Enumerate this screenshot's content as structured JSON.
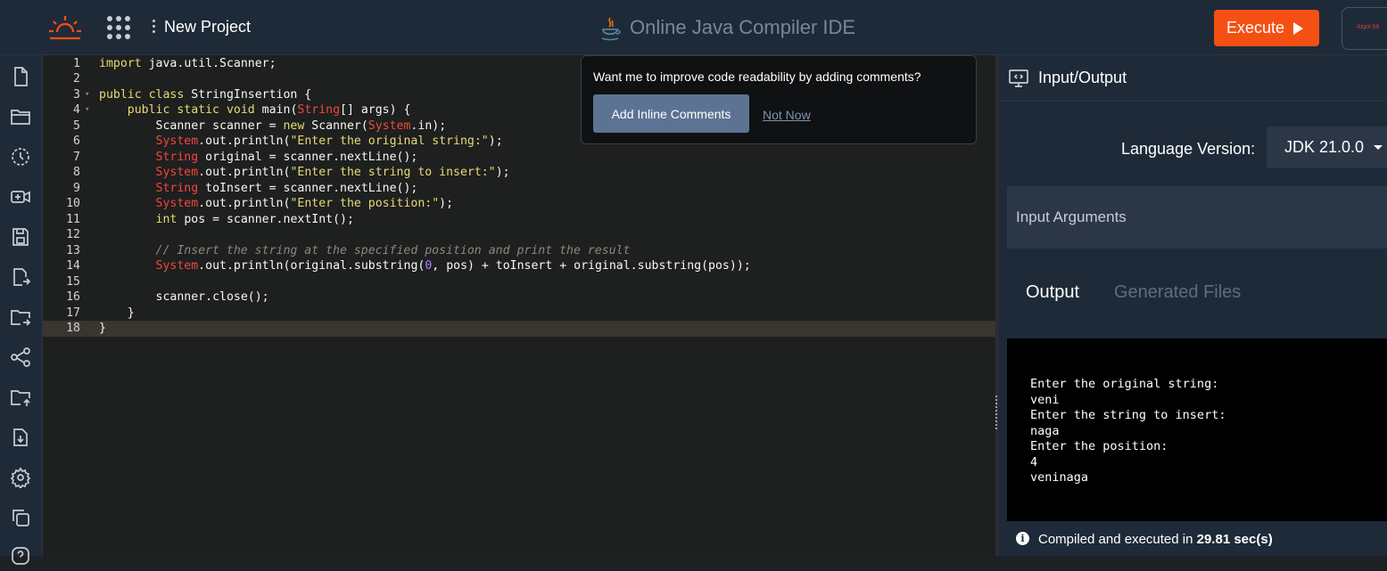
{
  "header": {
    "logo": "sun-logo-icon",
    "apps_icon": "apps-grid-icon",
    "menu_icon": "kebab-menu-icon",
    "project_name": "New Project",
    "java_icon": "java-cup-icon",
    "title": "Online Java Compiler IDE",
    "execute_label": "Execute",
    "ad_text": "Algol 68"
  },
  "sidebar": {
    "items": [
      {
        "icon": "new-file-icon"
      },
      {
        "icon": "open-folder-icon"
      },
      {
        "icon": "history-icon"
      },
      {
        "icon": "video-icon"
      },
      {
        "icon": "save-icon"
      },
      {
        "icon": "export-file-icon"
      },
      {
        "icon": "move-folder-icon"
      },
      {
        "icon": "share-icon"
      },
      {
        "icon": "upload-folder-icon"
      },
      {
        "icon": "download-file-icon"
      },
      {
        "icon": "settings-icon"
      },
      {
        "icon": "copy-icon"
      },
      {
        "icon": "help-icon"
      }
    ]
  },
  "editor": {
    "lines": [
      {
        "n": "1",
        "text": "import java.util.Scanner;"
      },
      {
        "n": "2",
        "text": ""
      },
      {
        "n": "3",
        "text": "public class StringInsertion {"
      },
      {
        "n": "4",
        "text": "    public static void main(String[] args) {"
      },
      {
        "n": "5",
        "text": "        Scanner scanner = new Scanner(System.in);"
      },
      {
        "n": "6",
        "text": "        System.out.println(\"Enter the original string:\");"
      },
      {
        "n": "7",
        "text": "        String original = scanner.nextLine();"
      },
      {
        "n": "8",
        "text": "        System.out.println(\"Enter the string to insert:\");"
      },
      {
        "n": "9",
        "text": "        String toInsert = scanner.nextLine();"
      },
      {
        "n": "10",
        "text": "        System.out.println(\"Enter the position:\");"
      },
      {
        "n": "11",
        "text": "        int pos = scanner.nextInt();"
      },
      {
        "n": "12",
        "text": ""
      },
      {
        "n": "13",
        "text": "        // Insert the string at the specified position and print the result"
      },
      {
        "n": "14",
        "text": "        System.out.println(original.substring(0, pos) + toInsert + original.substring(pos));"
      },
      {
        "n": "15",
        "text": ""
      },
      {
        "n": "16",
        "text": "        scanner.close();"
      },
      {
        "n": "17",
        "text": "    }"
      },
      {
        "n": "18",
        "text": "}"
      }
    ],
    "active_line": "18"
  },
  "popup": {
    "question": "Want me to improve code readability by adding comments?",
    "add_label": "Add Inline Comments",
    "dismiss_label": "Not Now"
  },
  "io_panel": {
    "icon": "monitor-code-icon",
    "title": "Input/Output",
    "language_label": "Language Version:",
    "language_value": "JDK 21.0.0",
    "args_placeholder": "Input Arguments",
    "tabs": {
      "output": "Output",
      "files": "Generated Files"
    },
    "console": [
      "Enter the original string:",
      "veni",
      "Enter the string to insert:",
      "naga",
      "Enter the position:",
      "4",
      "veninaga"
    ],
    "status": {
      "prefix": "Compiled and executed in",
      "time": "29.81 sec(s)"
    }
  }
}
